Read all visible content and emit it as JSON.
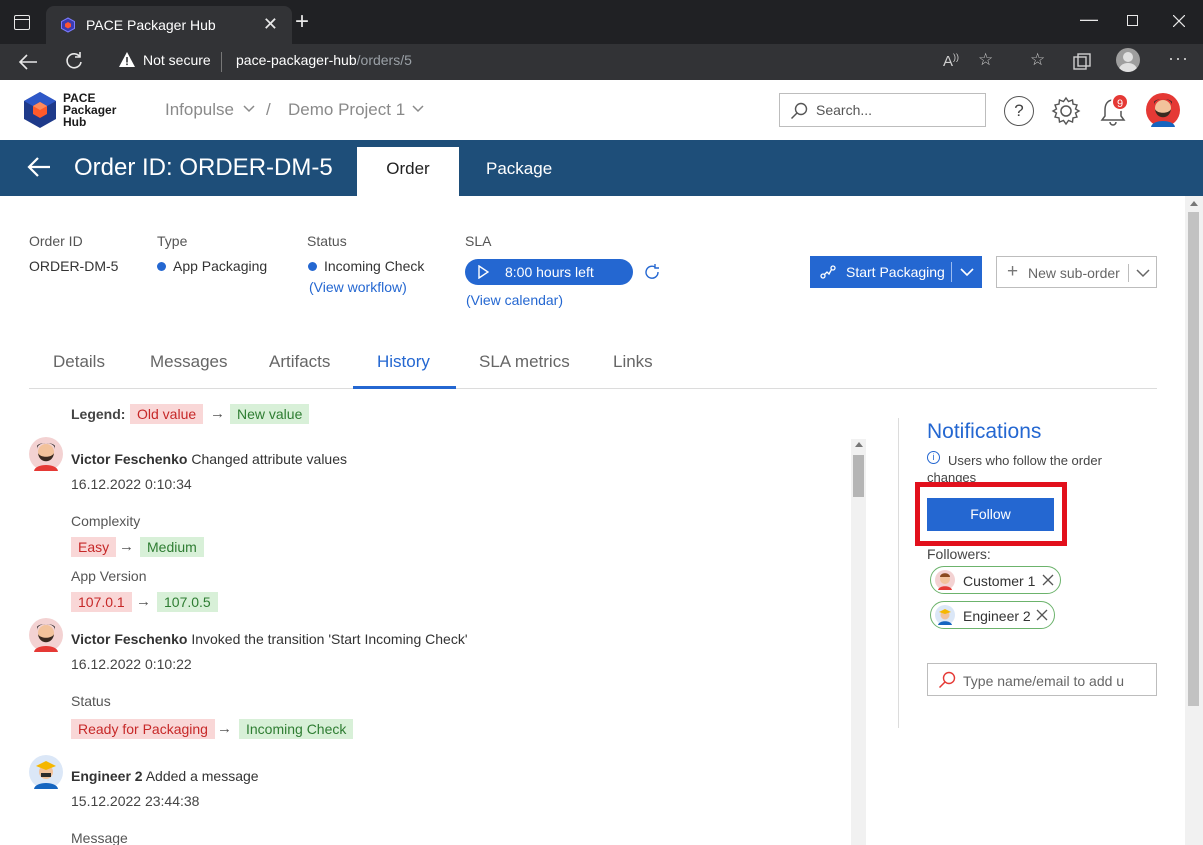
{
  "browser": {
    "tab_title": "PACE Packager Hub",
    "not_secure": "Not secure",
    "url_host": "pace-packager-hub",
    "url_path": "/orders/5"
  },
  "header": {
    "logo_line1": "PACE",
    "logo_line2": "Packager",
    "logo_line3": "Hub",
    "crumb_org": "Infopulse",
    "crumb_sep": "/",
    "crumb_project": "Demo Project 1",
    "search_placeholder": "Search...",
    "help_label": "?",
    "notification_count": "9"
  },
  "banner": {
    "title": "Order ID: ORDER-DM-5",
    "tab_order": "Order",
    "tab_package": "Package"
  },
  "meta": {
    "order_id_label": "Order ID",
    "order_id_value": "ORDER-DM-5",
    "type_label": "Type",
    "type_value": "App Packaging",
    "status_label": "Status",
    "status_value": "Incoming Check",
    "view_workflow": "(View workflow)",
    "sla_label": "SLA",
    "sla_value": "8:00 hours left",
    "view_calendar": "(View calendar)",
    "start_packaging": "Start Packaging",
    "new_sub_order": "New sub-order",
    "accent_color": "#2467d1"
  },
  "section_tabs": [
    "Details",
    "Messages",
    "Artifacts",
    "History",
    "SLA metrics",
    "Links"
  ],
  "history": {
    "legend_label": "Legend:",
    "legend_old": "Old value",
    "legend_new": "New value",
    "arrow": "→",
    "entries": [
      {
        "user": "Victor Feschenko",
        "action": "Changed attribute values",
        "date": "16.12.2022 0:10:34",
        "changes": [
          {
            "field": "Complexity",
            "old": "Easy",
            "new": "Medium"
          },
          {
            "field": "App Version",
            "old": "107.0.1",
            "new": "107.0.5"
          }
        ]
      },
      {
        "user": "Victor Feschenko",
        "action": "Invoked the transition 'Start Incoming Check'",
        "date": "16.12.2022 0:10:22",
        "changes": [
          {
            "field": "Status",
            "old": "Ready for Packaging",
            "new": "Incoming Check"
          }
        ]
      },
      {
        "user": "Engineer 2",
        "action": "Added a message",
        "date": "15.12.2022 23:44:38",
        "changes": [
          {
            "field": "Message"
          }
        ]
      }
    ]
  },
  "notifications": {
    "title": "Notifications",
    "description": "Users who follow the order changes",
    "follow_button": "Follow",
    "followers_label": "Followers:",
    "followers": [
      "Customer 1",
      "Engineer 2"
    ],
    "add_placeholder": "Type name/email to add u"
  }
}
